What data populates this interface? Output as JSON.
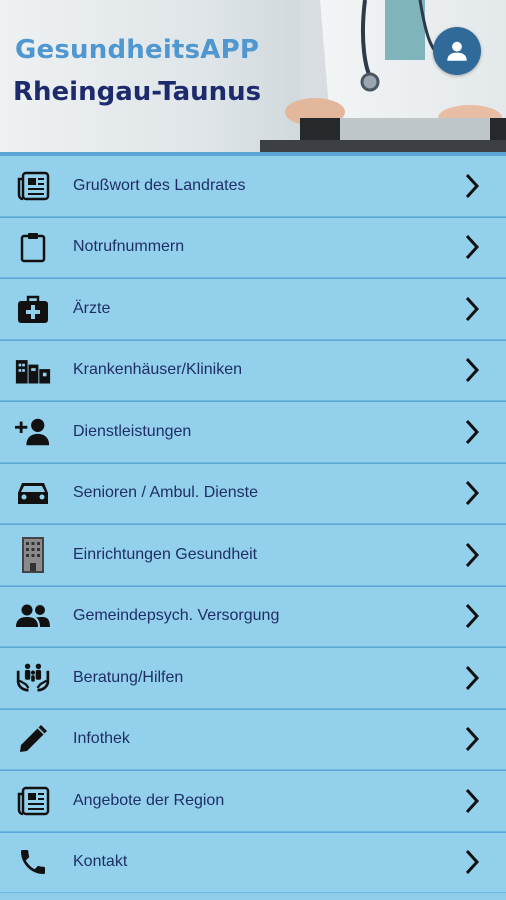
{
  "header": {
    "title_line1": "GesundheitsAPP",
    "title_line2": "Rheingau-Taunus",
    "avatar_icon": "account-circle-icon"
  },
  "menu": {
    "items": [
      {
        "label": "Grußwort des Landrates",
        "icon": "newspaper-icon"
      },
      {
        "label": "Notrufnummern",
        "icon": "clipboard-icon"
      },
      {
        "label": "Ärzte",
        "icon": "medical-bag-icon"
      },
      {
        "label": "Krankenhäuser/Kliniken",
        "icon": "city-buildings-icon"
      },
      {
        "label": "Dienstleistungen",
        "icon": "person-add-icon"
      },
      {
        "label": "Senioren / Ambul. Dienste",
        "icon": "car-icon"
      },
      {
        "label": "Einrichtungen Gesundheit",
        "icon": "building-icon"
      },
      {
        "label": "Gemeindepsych. Versorgung",
        "icon": "group-icon"
      },
      {
        "label": "Beratung/Hilfen",
        "icon": "family-hands-icon"
      },
      {
        "label": "Infothek",
        "icon": "pencil-icon"
      },
      {
        "label": "Angebote der Region",
        "icon": "newspaper-icon"
      },
      {
        "label": "Kontakt",
        "icon": "phone-icon"
      }
    ]
  },
  "colors": {
    "row_background": "#92d0ec",
    "row_border": "#5aa7d8",
    "label_text": "#1f2f66",
    "title_line1": "#4f97d0",
    "title_line2": "#1d2a6b",
    "avatar_bg": "#2f6a99"
  }
}
